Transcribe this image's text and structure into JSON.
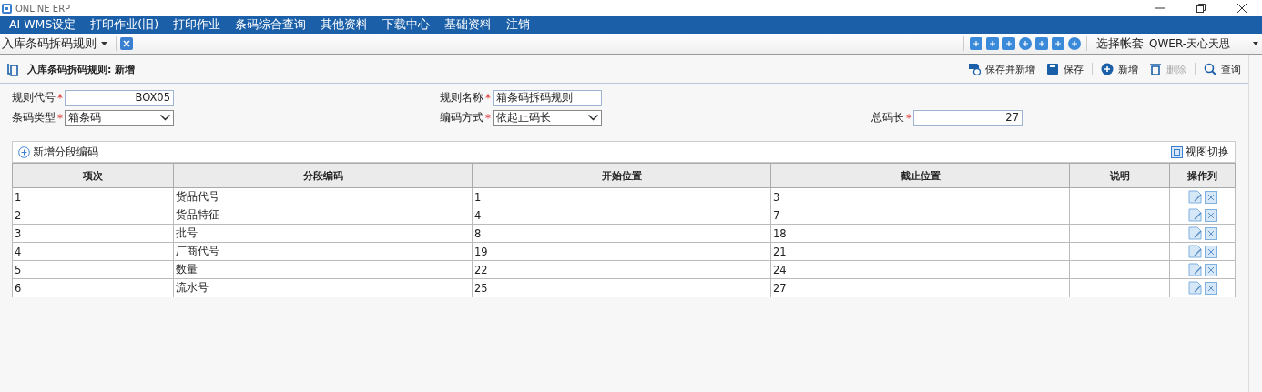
{
  "window": {
    "title": "ONLINE ERP"
  },
  "menu": [
    "AI-WMS设定",
    "打印作业(旧)",
    "打印作业",
    "条码综合查询",
    "其他资料",
    "下载中心",
    "基础资料",
    "注销"
  ],
  "tab": {
    "label": "入库条码拆码规则"
  },
  "account": {
    "label": "选择帐套",
    "value": "QWER-天心天思"
  },
  "page": {
    "title": "入库条码拆码规则: 新增"
  },
  "actions": [
    {
      "kind": "save-new",
      "label": "保存并新增",
      "disabled": false
    },
    {
      "kind": "save",
      "label": "保存",
      "disabled": false
    },
    {
      "kind": "add",
      "label": "新增",
      "disabled": false
    },
    {
      "kind": "delete",
      "label": "删除",
      "disabled": true
    },
    {
      "kind": "search",
      "label": "查询",
      "disabled": false
    }
  ],
  "form": [
    {
      "label": "规则代号",
      "required_mark": "*",
      "kind": "text",
      "value": "BOX05",
      "right_aligned": true
    },
    {
      "label": "规则名称",
      "required_mark": "*",
      "kind": "text",
      "value": "箱条码拆码规则",
      "right_aligned": false
    },
    {
      "label": "条码类型",
      "required_mark": "*",
      "kind": "select",
      "value": "箱条码"
    },
    {
      "label": "编码方式",
      "required_mark": "*",
      "kind": "select",
      "value": "依起止码长"
    },
    {
      "label": "总码长",
      "required_mark": "*",
      "kind": "text",
      "value": "27",
      "right_aligned": true
    }
  ],
  "grid": {
    "add_label": "新增分段编码",
    "view_label": "视图切换",
    "columns": [
      "项次",
      "分段编码",
      "开始位置",
      "截止位置",
      "说明",
      "操作列"
    ],
    "rows": [
      [
        "1",
        "货品代号",
        "1",
        "3"
      ],
      [
        "2",
        "货品特征",
        "4",
        "7"
      ],
      [
        "3",
        "批号",
        "8",
        "18"
      ],
      [
        "4",
        "厂商代号",
        "19",
        "21"
      ],
      [
        "5",
        "数量",
        "22",
        "24"
      ],
      [
        "6",
        "流水号",
        "25",
        "27"
      ]
    ]
  }
}
